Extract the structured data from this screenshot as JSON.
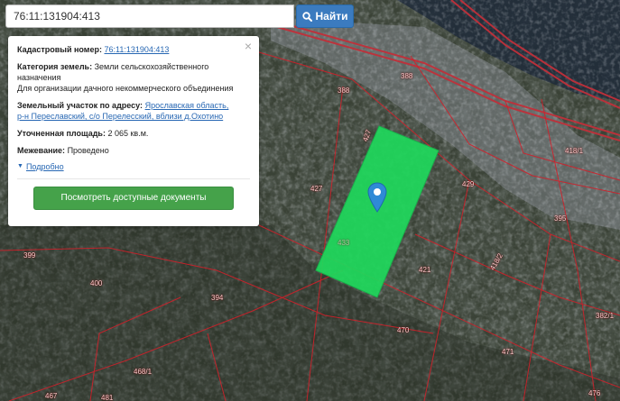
{
  "search": {
    "value": "76:11:131904:413",
    "button_label": "Найти"
  },
  "popup": {
    "cadastral_label": "Кадастровый номер:",
    "cadastral_value": "76:11:131904:413",
    "category_label": "Категория земель:",
    "category_value": "Земли сельскохозяйственного назначения",
    "category_purpose": "Для организации дачного некоммерческого объединения",
    "address_label": "Земельный участок по адресу:",
    "address_line1": "Ярославская область,",
    "address_line2": "р-н Переславский, с/о Перелесский, вблизи д.Охотино",
    "area_label": "Уточненная площадь:",
    "area_value": "2 065 кв.м.",
    "survey_label": "Межевание:",
    "survey_value": "Проведено",
    "more_label": "Подробно",
    "docs_button": "Посмотреть доступные документы",
    "close_symbol": "×"
  },
  "map": {
    "highlight_color": "#1fd95c",
    "boundary_color": "#d0202a",
    "road_color": "#c0303a",
    "marker_color": "#2f8ad6",
    "parcel_numbers": [
      "388",
      "388",
      "427",
      "427",
      "429",
      "418/1",
      "395",
      "399",
      "400",
      "421",
      "418/2",
      "394",
      "470",
      "382/1",
      "471",
      "468/1",
      "467",
      "481",
      "476",
      "433"
    ]
  }
}
